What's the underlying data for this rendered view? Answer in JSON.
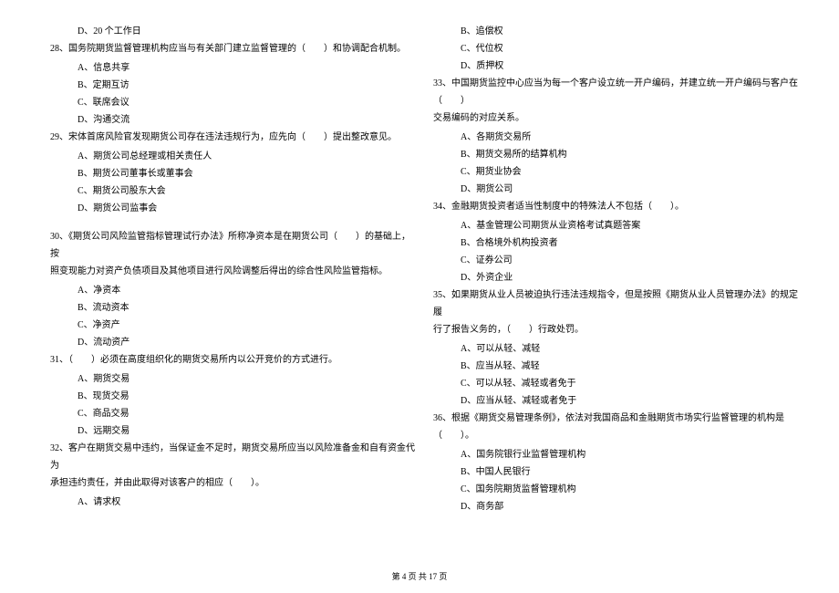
{
  "left_column": {
    "q27_d": "D、20 个工作日",
    "q28": {
      "text": "28、国务院期货监督管理机构应当与有关部门建立监督管理的（　　）和协调配合机制。",
      "a": "A、信息共享",
      "b": "B、定期互访",
      "c": "C、联席会议",
      "d": "D、沟通交流"
    },
    "q29": {
      "text": "29、宋体首席风险官发现期货公司存在违法违规行为，应先向（　　）提出整改意见。",
      "a": "A、期货公司总经理或相关责任人",
      "b": "B、期货公司董事长或董事会",
      "c": "C、期货公司股东大会",
      "d": "D、期货公司监事会"
    },
    "q30": {
      "text": "30、《期货公司风险监管指标管理试行办法》所称净资本是在期货公司（　　）的基础上，按",
      "text2": "照变现能力对资产负债项目及其他项目进行风险调整后得出的综合性风险监管指标。",
      "a": "A、净资本",
      "b": "B、流动资本",
      "c": "C、净资产",
      "d": "D、流动资产"
    },
    "q31": {
      "text": "31、（　　）必须在高度组织化的期货交易所内以公开竞价的方式进行。",
      "a": "A、期货交易",
      "b": "B、现货交易",
      "c": "C、商品交易",
      "d": "D、远期交易"
    },
    "q32": {
      "text": "32、客户在期货交易中违约，当保证金不足时，期货交易所应当以风险准备金和自有资金代为",
      "text2": "承担违约责任，并由此取得对该客户的相应（　　）。",
      "a": "A、请求权"
    }
  },
  "right_column": {
    "q32_cont": {
      "b": "B、追偿权",
      "c": "C、代位权",
      "d": "D、质押权"
    },
    "q33": {
      "text": "33、中国期货监控中心应当为每一个客户设立统一开户编码，并建立统一开户编码与客户在（　　）",
      "text2": "交易编码的对应关系。",
      "a": "A、各期货交易所",
      "b": "B、期货交易所的结算机构",
      "c": "C、期货业协会",
      "d": "D、期货公司"
    },
    "q34": {
      "text": "34、金融期货投资者适当性制度中的特殊法人不包括（　　）。",
      "a": "A、基金管理公司期货从业资格考试真题答案",
      "b": "B、合格境外机构投资者",
      "c": "C、证券公司",
      "d": "D、外资企业"
    },
    "q35": {
      "text": "35、如果期货从业人员被迫执行违法违规指令，但是按照《期货从业人员管理办法》的规定履",
      "text2": "行了报告义务的，（　　）行政处罚。",
      "a": "A、可以从轻、减轻",
      "b": "B、应当从轻、减轻",
      "c": "C、可以从轻、减轻或者免于",
      "d": "D、应当从轻、减轻或者免于"
    },
    "q36": {
      "text": "36、根据《期货交易管理条例》，依法对我国商品和金融期货市场实行监督管理的机构是",
      "text2": "（　　）。",
      "a": "A、国务院银行业监督管理机构",
      "b": "B、中国人民银行",
      "c": "C、国务院期货监督管理机构",
      "d": "D、商务部"
    }
  },
  "footer": "第 4 页 共 17 页"
}
